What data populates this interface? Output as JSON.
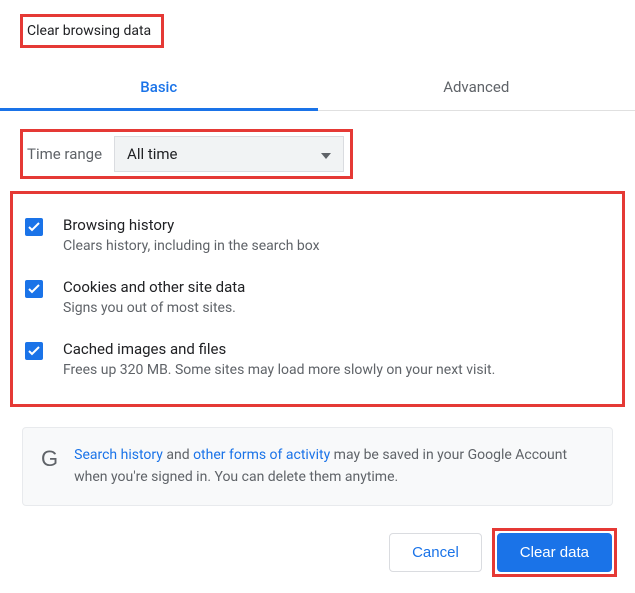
{
  "title": "Clear browsing data",
  "tabs": {
    "basic": "Basic",
    "advanced": "Advanced"
  },
  "timerange": {
    "label": "Time range",
    "value": "All time"
  },
  "options": [
    {
      "title": "Browsing history",
      "desc": "Clears history, including in the search box"
    },
    {
      "title": "Cookies and other site data",
      "desc": "Signs you out of most sites."
    },
    {
      "title": "Cached images and files",
      "desc": "Frees up 320 MB. Some sites may load more slowly on your next visit."
    }
  ],
  "notice": {
    "link1": "Search history",
    "mid1": " and ",
    "link2": "other forms of activity",
    "rest": " may be saved in your Google Account when you're signed in. You can delete them anytime."
  },
  "buttons": {
    "cancel": "Cancel",
    "clear": "Clear data"
  }
}
